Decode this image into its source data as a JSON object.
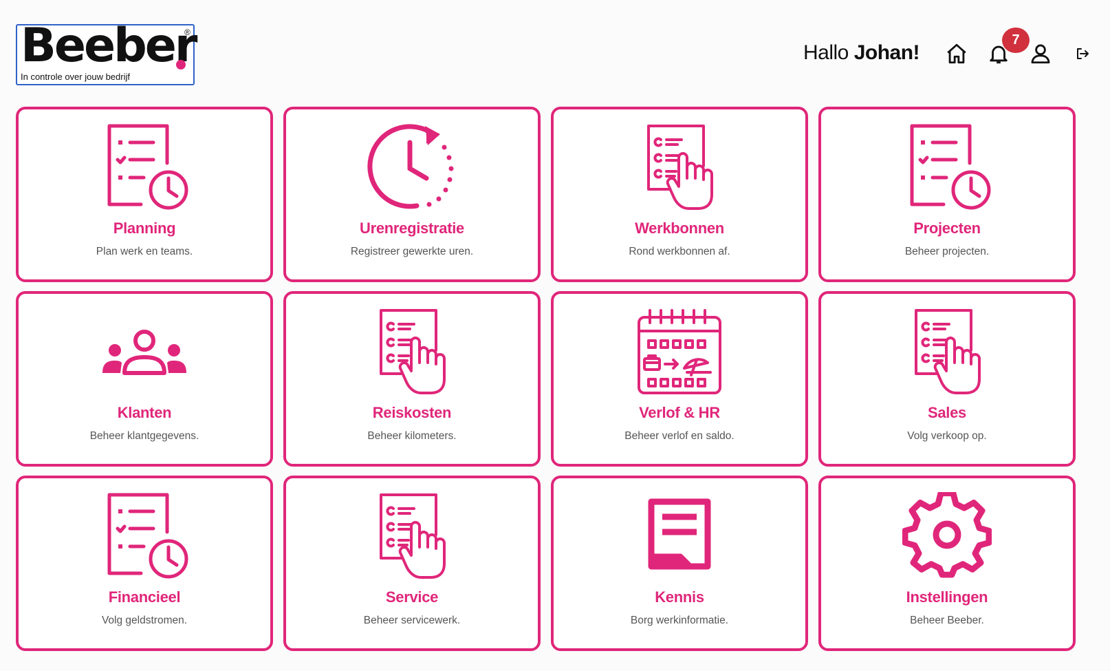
{
  "logo": {
    "word": "Beeber",
    "reg": "®",
    "tagline": "In controle over jouw bedrijf"
  },
  "header": {
    "greeting_prefix": "Hallo ",
    "user_name": "Johan!",
    "notification_count": "7",
    "icons": [
      "home-icon",
      "bell-icon",
      "user-icon",
      "logout-icon"
    ]
  },
  "colors": {
    "accent": "#e0267a",
    "badge": "#d1303d",
    "text": "#111111",
    "muted": "#555555"
  },
  "tiles": [
    {
      "title": "Planning",
      "desc": "Plan werk en teams.",
      "icon": "checklist-clock-icon"
    },
    {
      "title": "Urenregistratie",
      "desc": "Registreer gewerkte uren.",
      "icon": "clock-refresh-icon"
    },
    {
      "title": "Werkbonnen",
      "desc": "Rond werkbonnen af.",
      "icon": "checklist-hand-icon"
    },
    {
      "title": "Projecten",
      "desc": "Beheer projecten.",
      "icon": "checklist-clock-icon"
    },
    {
      "title": "Klanten",
      "desc": "Beheer klantgegevens.",
      "icon": "people-icon"
    },
    {
      "title": "Reiskosten",
      "desc": "Beheer kilometers.",
      "icon": "checklist-hand-icon"
    },
    {
      "title": "Verlof & HR",
      "desc": "Beheer verlof en saldo.",
      "icon": "calendar-vacation-icon"
    },
    {
      "title": "Sales",
      "desc": "Volg verkoop op.",
      "icon": "checklist-hand-icon"
    },
    {
      "title": "Financieel",
      "desc": "Volg geldstromen.",
      "icon": "checklist-clock-icon"
    },
    {
      "title": "Service",
      "desc": "Beheer servicewerk.",
      "icon": "checklist-hand-icon"
    },
    {
      "title": "Kennis",
      "desc": "Borg werkinformatie.",
      "icon": "document-icon"
    },
    {
      "title": "Instellingen",
      "desc": "Beheer Beeber.",
      "icon": "gear-icon"
    }
  ]
}
